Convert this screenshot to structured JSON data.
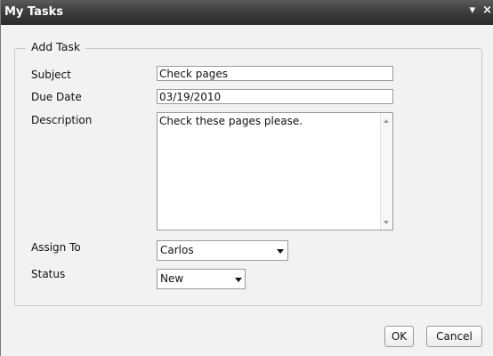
{
  "window": {
    "title": "My Tasks",
    "minimize_glyph": "▾",
    "close_glyph": "×"
  },
  "form": {
    "legend": "Add Task",
    "subject": {
      "label": "Subject",
      "value": "Check pages"
    },
    "due_date": {
      "label": "Due Date",
      "value": "03/19/2010"
    },
    "description": {
      "label": "Description",
      "value": "Check these pages please."
    },
    "assign_to": {
      "label": "Assign To",
      "selected": "Carlos"
    },
    "status": {
      "label": "Status",
      "selected": "New"
    }
  },
  "buttons": {
    "ok": "OK",
    "cancel": "Cancel"
  },
  "icons": {
    "minimize": "chevron-down-icon",
    "close": "close-icon",
    "scroll_up": "scroll-up-arrow-icon",
    "scroll_down": "scroll-down-arrow-icon",
    "dropdown": "chevron-down-icon"
  },
  "colors": {
    "titlebar": "#3a3a3a",
    "title_text": "#ffffff",
    "panel_background": "#f2f2f2"
  }
}
